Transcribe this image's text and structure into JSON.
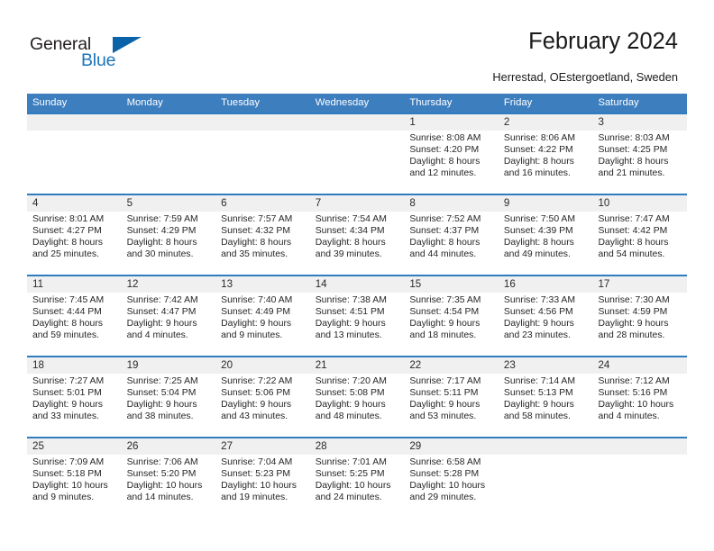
{
  "logo": {
    "word_one": "General",
    "word_two": "Blue",
    "triangle": "triangle-mark"
  },
  "header": {
    "title": "February 2024",
    "subtitle": "Herrestad, OEstergoetland, Sweden"
  },
  "colors": {
    "header_blue": "#3d7ebf",
    "rule_blue": "#2f7cc0",
    "daynum_band": "#f0f0f0",
    "logo_blue": "#1b75bb",
    "logo_dark": "#231f20"
  },
  "weekday_headers": [
    "Sunday",
    "Monday",
    "Tuesday",
    "Wednesday",
    "Thursday",
    "Friday",
    "Saturday"
  ],
  "weeks": [
    [
      {
        "day": "",
        "lines": []
      },
      {
        "day": "",
        "lines": []
      },
      {
        "day": "",
        "lines": []
      },
      {
        "day": "",
        "lines": []
      },
      {
        "day": "1",
        "lines": [
          "Sunrise: 8:08 AM",
          "Sunset: 4:20 PM",
          "Daylight: 8 hours",
          "and 12 minutes."
        ]
      },
      {
        "day": "2",
        "lines": [
          "Sunrise: 8:06 AM",
          "Sunset: 4:22 PM",
          "Daylight: 8 hours",
          "and 16 minutes."
        ]
      },
      {
        "day": "3",
        "lines": [
          "Sunrise: 8:03 AM",
          "Sunset: 4:25 PM",
          "Daylight: 8 hours",
          "and 21 minutes."
        ]
      }
    ],
    [
      {
        "day": "4",
        "lines": [
          "Sunrise: 8:01 AM",
          "Sunset: 4:27 PM",
          "Daylight: 8 hours",
          "and 25 minutes."
        ]
      },
      {
        "day": "5",
        "lines": [
          "Sunrise: 7:59 AM",
          "Sunset: 4:29 PM",
          "Daylight: 8 hours",
          "and 30 minutes."
        ]
      },
      {
        "day": "6",
        "lines": [
          "Sunrise: 7:57 AM",
          "Sunset: 4:32 PM",
          "Daylight: 8 hours",
          "and 35 minutes."
        ]
      },
      {
        "day": "7",
        "lines": [
          "Sunrise: 7:54 AM",
          "Sunset: 4:34 PM",
          "Daylight: 8 hours",
          "and 39 minutes."
        ]
      },
      {
        "day": "8",
        "lines": [
          "Sunrise: 7:52 AM",
          "Sunset: 4:37 PM",
          "Daylight: 8 hours",
          "and 44 minutes."
        ]
      },
      {
        "day": "9",
        "lines": [
          "Sunrise: 7:50 AM",
          "Sunset: 4:39 PM",
          "Daylight: 8 hours",
          "and 49 minutes."
        ]
      },
      {
        "day": "10",
        "lines": [
          "Sunrise: 7:47 AM",
          "Sunset: 4:42 PM",
          "Daylight: 8 hours",
          "and 54 minutes."
        ]
      }
    ],
    [
      {
        "day": "11",
        "lines": [
          "Sunrise: 7:45 AM",
          "Sunset: 4:44 PM",
          "Daylight: 8 hours",
          "and 59 minutes."
        ]
      },
      {
        "day": "12",
        "lines": [
          "Sunrise: 7:42 AM",
          "Sunset: 4:47 PM",
          "Daylight: 9 hours",
          "and 4 minutes."
        ]
      },
      {
        "day": "13",
        "lines": [
          "Sunrise: 7:40 AM",
          "Sunset: 4:49 PM",
          "Daylight: 9 hours",
          "and 9 minutes."
        ]
      },
      {
        "day": "14",
        "lines": [
          "Sunrise: 7:38 AM",
          "Sunset: 4:51 PM",
          "Daylight: 9 hours",
          "and 13 minutes."
        ]
      },
      {
        "day": "15",
        "lines": [
          "Sunrise: 7:35 AM",
          "Sunset: 4:54 PM",
          "Daylight: 9 hours",
          "and 18 minutes."
        ]
      },
      {
        "day": "16",
        "lines": [
          "Sunrise: 7:33 AM",
          "Sunset: 4:56 PM",
          "Daylight: 9 hours",
          "and 23 minutes."
        ]
      },
      {
        "day": "17",
        "lines": [
          "Sunrise: 7:30 AM",
          "Sunset: 4:59 PM",
          "Daylight: 9 hours",
          "and 28 minutes."
        ]
      }
    ],
    [
      {
        "day": "18",
        "lines": [
          "Sunrise: 7:27 AM",
          "Sunset: 5:01 PM",
          "Daylight: 9 hours",
          "and 33 minutes."
        ]
      },
      {
        "day": "19",
        "lines": [
          "Sunrise: 7:25 AM",
          "Sunset: 5:04 PM",
          "Daylight: 9 hours",
          "and 38 minutes."
        ]
      },
      {
        "day": "20",
        "lines": [
          "Sunrise: 7:22 AM",
          "Sunset: 5:06 PM",
          "Daylight: 9 hours",
          "and 43 minutes."
        ]
      },
      {
        "day": "21",
        "lines": [
          "Sunrise: 7:20 AM",
          "Sunset: 5:08 PM",
          "Daylight: 9 hours",
          "and 48 minutes."
        ]
      },
      {
        "day": "22",
        "lines": [
          "Sunrise: 7:17 AM",
          "Sunset: 5:11 PM",
          "Daylight: 9 hours",
          "and 53 minutes."
        ]
      },
      {
        "day": "23",
        "lines": [
          "Sunrise: 7:14 AM",
          "Sunset: 5:13 PM",
          "Daylight: 9 hours",
          "and 58 minutes."
        ]
      },
      {
        "day": "24",
        "lines": [
          "Sunrise: 7:12 AM",
          "Sunset: 5:16 PM",
          "Daylight: 10 hours",
          "and 4 minutes."
        ]
      }
    ],
    [
      {
        "day": "25",
        "lines": [
          "Sunrise: 7:09 AM",
          "Sunset: 5:18 PM",
          "Daylight: 10 hours",
          "and 9 minutes."
        ]
      },
      {
        "day": "26",
        "lines": [
          "Sunrise: 7:06 AM",
          "Sunset: 5:20 PM",
          "Daylight: 10 hours",
          "and 14 minutes."
        ]
      },
      {
        "day": "27",
        "lines": [
          "Sunrise: 7:04 AM",
          "Sunset: 5:23 PM",
          "Daylight: 10 hours",
          "and 19 minutes."
        ]
      },
      {
        "day": "28",
        "lines": [
          "Sunrise: 7:01 AM",
          "Sunset: 5:25 PM",
          "Daylight: 10 hours",
          "and 24 minutes."
        ]
      },
      {
        "day": "29",
        "lines": [
          "Sunrise: 6:58 AM",
          "Sunset: 5:28 PM",
          "Daylight: 10 hours",
          "and 29 minutes."
        ]
      },
      {
        "day": "",
        "lines": []
      },
      {
        "day": "",
        "lines": []
      }
    ]
  ]
}
